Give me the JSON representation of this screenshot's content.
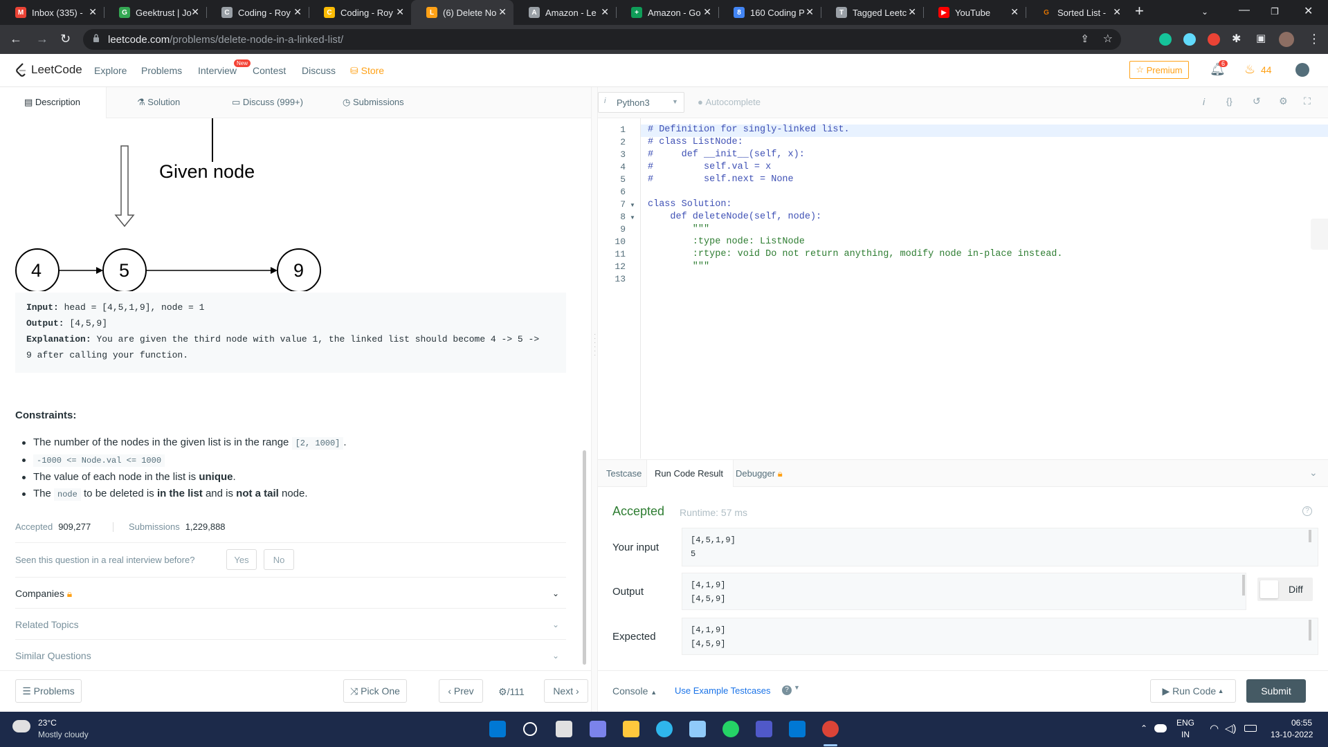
{
  "browser": {
    "tabs": [
      {
        "title": "Inbox (335) -",
        "color": "#ea4335",
        "glyph": "M"
      },
      {
        "title": "Geektrust | Jo",
        "color": "#34a853",
        "glyph": "G"
      },
      {
        "title": "Coding - Roy",
        "color": "#9aa0a6",
        "glyph": "C"
      },
      {
        "title": "Coding - Roy",
        "color": "#fbbc04",
        "glyph": "C"
      },
      {
        "title": "(6) Delete No",
        "color": "#ffa116",
        "glyph": "L"
      },
      {
        "title": "Amazon - Le",
        "color": "#9aa0a6",
        "glyph": "A"
      },
      {
        "title": "Amazon - Go",
        "color": "#0f9d58",
        "glyph": "+"
      },
      {
        "title": "160 Coding P",
        "color": "#4285f4",
        "glyph": "8"
      },
      {
        "title": "Tagged Leetc",
        "color": "#9aa0a6",
        "glyph": "T"
      },
      {
        "title": "YouTube",
        "color": "#ff0000",
        "glyph": "▶"
      },
      {
        "title": "Sorted List -",
        "color": "#e37400",
        "glyph": "G"
      }
    ],
    "url_host": "leetcode.com",
    "url_path": "/problems/delete-node-in-a-linked-list/"
  },
  "lc_nav": {
    "brand": "LeetCode",
    "links": [
      "Explore",
      "Problems",
      "Interview",
      "Contest",
      "Discuss"
    ],
    "new_badge": "New",
    "store": "Store",
    "premium": "Premium",
    "notif_count": "6",
    "streak": "44"
  },
  "problem_tabs": [
    "Description",
    "Solution",
    "Discuss (999+)",
    "Submissions"
  ],
  "diagram": {
    "label": "Given node",
    "nodes": [
      "4",
      "5",
      "9"
    ]
  },
  "example": {
    "input_label": "Input:",
    "input_value": "head = [4,5,1,9], node = 1",
    "output_label": "Output:",
    "output_value": "[4,5,9]",
    "explanation_label": "Explanation:",
    "explanation_line1": "You are given the third node with value 1, the linked list should become 4 -> 5 ->",
    "explanation_line2": "9 after calling your function."
  },
  "constraints": {
    "title": "Constraints:",
    "c1_pre": "The number of the nodes in the given list is in the range",
    "c1_code": "[2, 1000]",
    "c1_post": ".",
    "c2_code": "-1000 <= Node.val <= 1000",
    "c3_pre": "The value of each node in the list is",
    "c3_bold": "unique",
    "c3_post": ".",
    "c4_pre": "The",
    "c4_code": "node",
    "c4_mid": "to be deleted is",
    "c4_bold1": "in the list",
    "c4_mid2": "and is",
    "c4_bold2": "not a tail",
    "c4_post": "node."
  },
  "stats": {
    "accepted_label": "Accepted",
    "accepted_value": "909,277",
    "submissions_label": "Submissions",
    "submissions_value": "1,229,888"
  },
  "interview_q": "Seen this question in a real interview before?",
  "yes": "Yes",
  "no": "No",
  "accordions": [
    "Companies",
    "Related Topics",
    "Similar Questions"
  ],
  "left_footer": {
    "problems": "Problems",
    "pick_one": "Pick One",
    "prev": "Prev",
    "page": "/111",
    "next": "Next"
  },
  "editor": {
    "language": "Python3",
    "autocomplete": "Autocomplete",
    "line_numbers": [
      "1",
      "2",
      "3",
      "4",
      "5",
      "6",
      "7",
      "8",
      "9",
      "10",
      "11",
      "12",
      "13"
    ],
    "lines": [
      "# Definition for singly-linked list.",
      "# class ListNode:",
      "#     def __init__(self, x):",
      "#         self.val = x",
      "#         self.next = None",
      "",
      "class Solution:",
      "    def deleteNode(self, node):",
      "        \"\"\"",
      "        :type node: ListNode",
      "        :rtype: void Do not return anything, modify node in-place instead.",
      "        \"\"\"",
      ""
    ]
  },
  "console": {
    "tabs": [
      "Testcase",
      "Run Code Result",
      "Debugger"
    ],
    "status": "Accepted",
    "runtime": "Runtime: 57 ms",
    "your_input_label": "Your input",
    "your_input_l1": "[4,5,1,9]",
    "your_input_l2": "5",
    "output_label": "Output",
    "output_l1": "[4,1,9]",
    "output_l2": "[4,5,9]",
    "expected_label": "Expected",
    "expected_l1": "[4,1,9]",
    "expected_l2": "[4,5,9]",
    "diff": "Diff"
  },
  "right_footer": {
    "console": "Console",
    "use_example": "Use Example Testcases",
    "run_code": "Run Code",
    "submit": "Submit"
  },
  "taskbar": {
    "temp": "23°C",
    "weather": "Mostly cloudy",
    "lang1": "ENG",
    "lang2": "IN",
    "time": "06:55",
    "date": "13-10-2022"
  },
  "colors": {
    "accepted_green": "#2e7d32",
    "brand_orange": "#ffa116",
    "submit_bg": "#455a64"
  }
}
